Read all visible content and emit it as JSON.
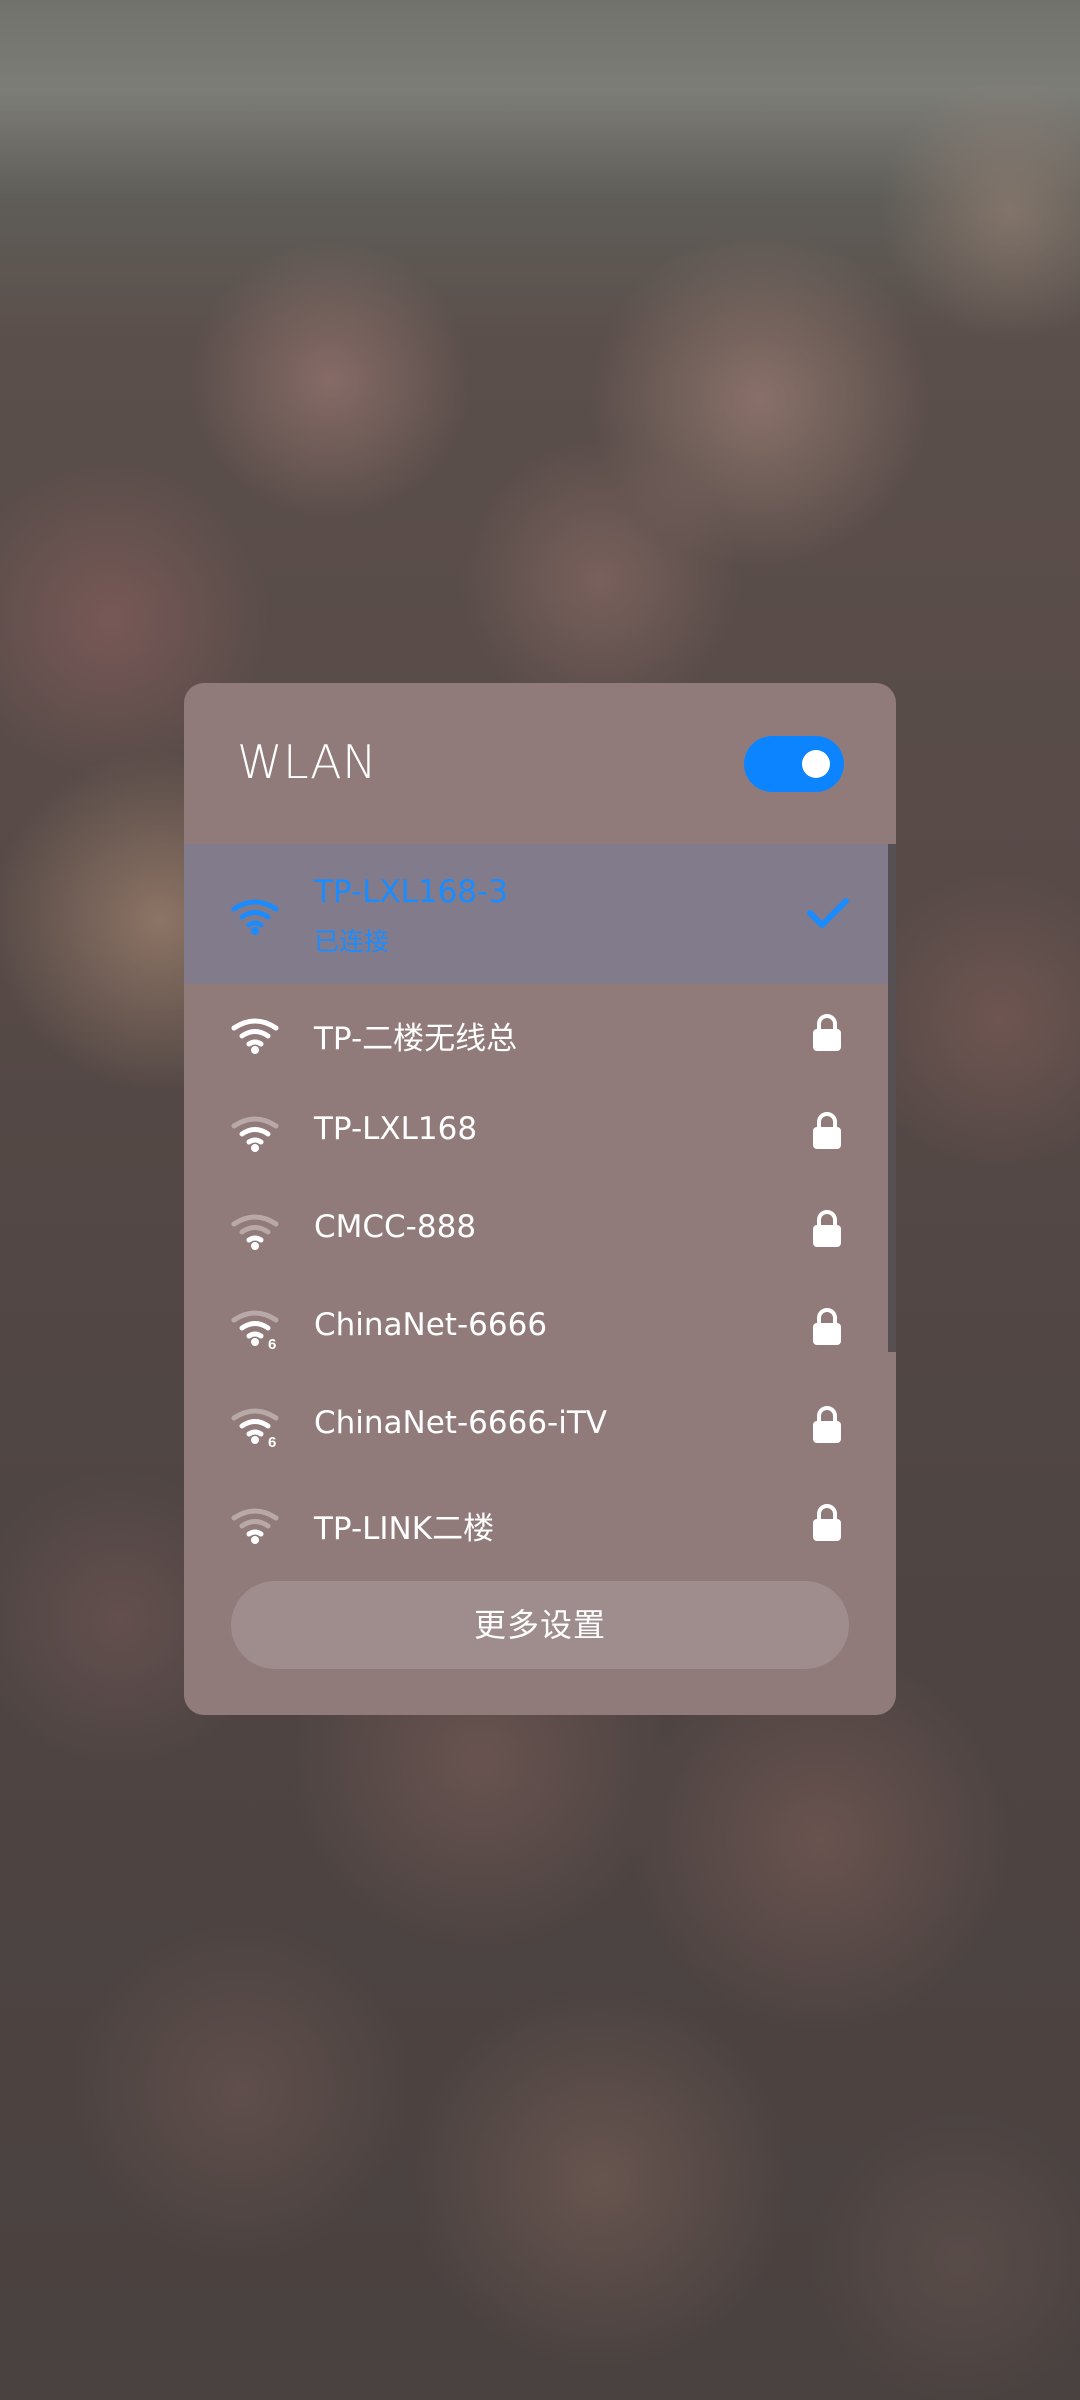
{
  "panel": {
    "title": "WLAN",
    "toggle": {
      "state": "on",
      "color": "#0d84ff"
    },
    "networks": [
      {
        "name": "TP-LXL168-3",
        "status": "已连接",
        "icon": "wifi-icon",
        "connected": true,
        "secured": false,
        "wifi6": false,
        "signal": 3
      },
      {
        "name": "TP-二楼无线总",
        "icon": "wifi-icon",
        "connected": false,
        "secured": true,
        "wifi6": false,
        "signal": 3
      },
      {
        "name": "TP-LXL168",
        "icon": "wifi-icon",
        "connected": false,
        "secured": true,
        "wifi6": false,
        "signal": 2
      },
      {
        "name": "CMCC-888",
        "icon": "wifi-icon",
        "connected": false,
        "secured": true,
        "wifi6": false,
        "signal": 1
      },
      {
        "name": "ChinaNet-6666",
        "icon": "wifi6-icon",
        "badge": "6",
        "connected": false,
        "secured": true,
        "wifi6": true,
        "signal": 2
      },
      {
        "name": "ChinaNet-6666-iTV",
        "icon": "wifi6-icon",
        "badge": "6",
        "connected": false,
        "secured": true,
        "wifi6": true,
        "signal": 2
      },
      {
        "name": "TP-LINK二楼",
        "icon": "wifi-icon",
        "connected": false,
        "secured": true,
        "wifi6": false,
        "signal": 1
      }
    ],
    "more_settings_label": "更多设置",
    "colors": {
      "panel_bg": "#907b7a",
      "active_row_bg": "#827b8b",
      "accent": "#0d84ff",
      "connected_text": "#1a8cff"
    }
  }
}
